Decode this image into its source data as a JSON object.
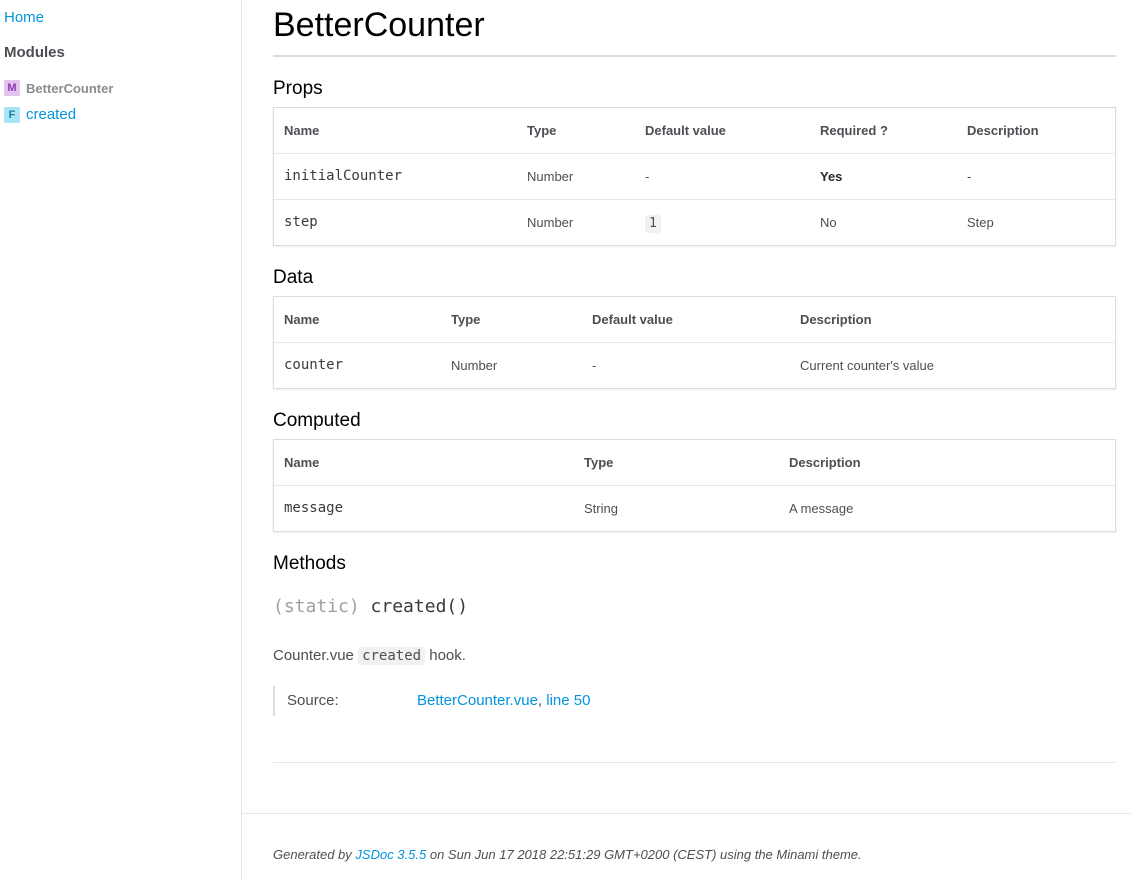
{
  "sidebar": {
    "home": "Home",
    "modules_heading": "Modules",
    "items": [
      {
        "badge": "M",
        "label": "BetterCounter"
      },
      {
        "badge": "F",
        "label": "created"
      }
    ]
  },
  "main": {
    "title": "BetterCounter",
    "props": {
      "heading": "Props",
      "columns": [
        "Name",
        "Type",
        "Default value",
        "Required ?",
        "Description"
      ],
      "rows": [
        [
          "initialCounter",
          "Number",
          "-",
          "Yes",
          "-"
        ],
        [
          "step",
          "Number",
          "1",
          "No",
          "Step"
        ]
      ]
    },
    "data": {
      "heading": "Data",
      "columns": [
        "Name",
        "Type",
        "Default value",
        "Description"
      ],
      "rows": [
        [
          "counter",
          "Number",
          "-",
          "Current counter's value"
        ]
      ]
    },
    "computed": {
      "heading": "Computed",
      "columns": [
        "Name",
        "Type",
        "Description"
      ],
      "rows": [
        [
          "message",
          "String",
          "A message"
        ]
      ]
    },
    "methods": {
      "heading": "Methods",
      "static_prefix": "(static)",
      "signature": "created()",
      "desc_prefix": "Counter.vue",
      "desc_code": "created",
      "desc_suffix": "hook.",
      "source_label": "Source:",
      "source_file": "BetterCounter.vue",
      "source_sep": ",",
      "source_line": "line 50"
    }
  },
  "footer": {
    "prefix": "Generated by",
    "link": "JSDoc 3.5.5",
    "suffix": "on Sun Jun 17 2018 22:51:29 GMT+0200 (CEST) using the Minami theme."
  }
}
